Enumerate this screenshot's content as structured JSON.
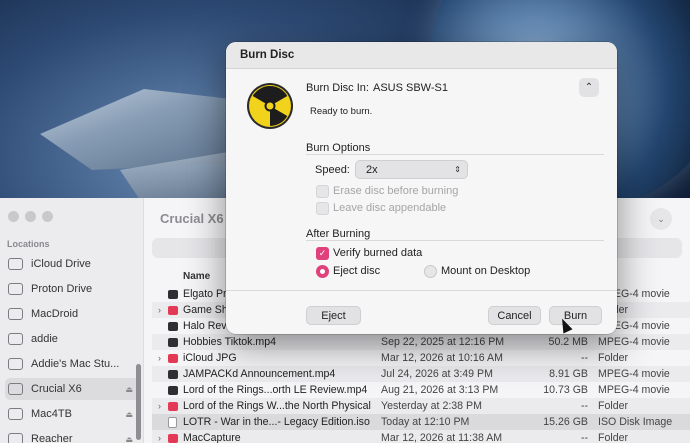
{
  "dialog": {
    "title": "Burn Disc",
    "burn_in_label": "Burn Disc In:",
    "device": "ASUS SBW-S1",
    "status": "Ready to burn.",
    "burn_options_heading": "Burn Options",
    "speed_label": "Speed:",
    "speed_value": "2x",
    "erase_label": "Erase disc before burning",
    "appendable_label": "Leave disc appendable",
    "after_heading": "After Burning",
    "verify_label": "Verify burned data",
    "eject_radio_label": "Eject disc",
    "mount_radio_label": "Mount on Desktop",
    "eject_button": "Eject",
    "cancel_button": "Cancel",
    "burn_button": "Burn",
    "accent_color": "#e0407b"
  },
  "finder": {
    "title": "Crucial X6",
    "sidebar_heading": "Locations",
    "sidebar_items": [
      {
        "label": "iCloud Drive",
        "icon": "cloud-icon"
      },
      {
        "label": "Proton Drive",
        "icon": "folder-icon"
      },
      {
        "label": "MacDroid",
        "icon": "folder-icon"
      },
      {
        "label": "addie",
        "icon": "home-icon"
      },
      {
        "label": "Addie's Mac Stu...",
        "icon": "computer-icon"
      },
      {
        "label": "Crucial X6",
        "icon": "drive-icon",
        "eject": "⏏"
      },
      {
        "label": "Mac4TB",
        "icon": "drive-icon",
        "eject": "⏏"
      },
      {
        "label": "Reacher",
        "icon": "drive-icon",
        "eject": "⏏"
      }
    ],
    "column_name": "Name",
    "files": [
      {
        "chev": "",
        "icon": "video",
        "name": "Elgato Pr",
        "date": "",
        "size": "",
        "kind": "MPEG-4 movie"
      },
      {
        "chev": "›",
        "icon": "folder",
        "name": "Game Sh",
        "date": "",
        "size": "",
        "kind": "Folder"
      },
      {
        "chev": "",
        "icon": "video",
        "name": "Halo Revi",
        "date": "",
        "size": "",
        "kind": "MPEG-4 movie"
      },
      {
        "chev": "",
        "icon": "video",
        "name": "Hobbies Tiktok.mp4",
        "date": "Sep 22, 2025 at 12:16 PM",
        "size": "50.2 MB",
        "kind": "MPEG-4 movie"
      },
      {
        "chev": "›",
        "icon": "folder",
        "name": "iCloud JPG",
        "date": "Mar 12, 2026 at 10:16 AM",
        "size": "--",
        "kind": "Folder"
      },
      {
        "chev": "",
        "icon": "video",
        "name": "JAMPACKd Announcement.mp4",
        "date": "Jul 24, 2026 at 3:49 PM",
        "size": "8.91 GB",
        "kind": "MPEG-4 movie"
      },
      {
        "chev": "",
        "icon": "video",
        "name": "Lord of the Rings...orth LE Review.mp4",
        "date": "Aug 21, 2026 at 3:13 PM",
        "size": "10.73 GB",
        "kind": "MPEG-4 movie"
      },
      {
        "chev": "›",
        "icon": "folder",
        "name": "Lord of the Rings W...the North Physical",
        "date": "Yesterday at 2:38 PM",
        "size": "--",
        "kind": "Folder"
      },
      {
        "chev": "",
        "icon": "file",
        "name": "LOTR - War in the...- Legacy Edition.iso",
        "date": "Today at 12:10 PM",
        "size": "15.26 GB",
        "kind": "ISO Disk Image"
      },
      {
        "chev": "›",
        "icon": "folder",
        "name": "MacCapture",
        "date": "Mar 12, 2026 at 11:38 AM",
        "size": "--",
        "kind": "Folder"
      }
    ]
  }
}
